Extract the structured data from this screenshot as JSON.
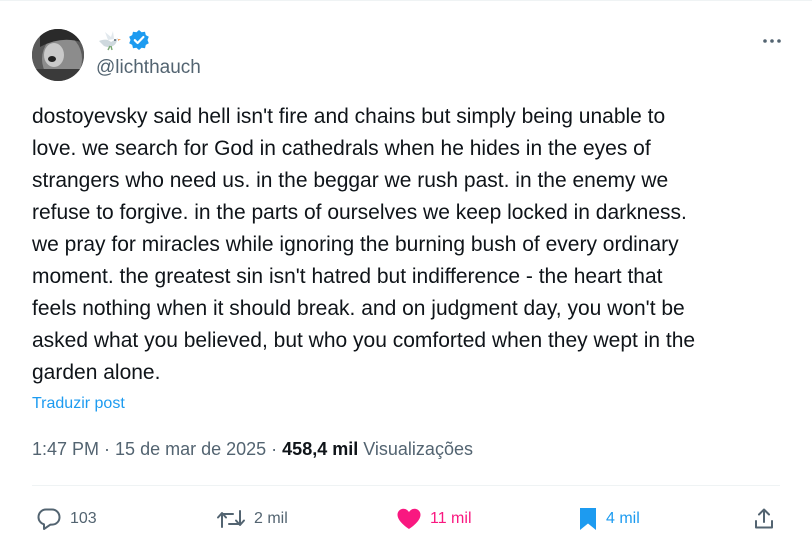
{
  "author": {
    "handle": "@lichthauch",
    "emoji_icon": "dove-icon",
    "verified_icon": "verified-badge-icon"
  },
  "post": {
    "text": "dostoyevsky said hell isn't fire and chains but simply being unable to\nlove. we search for God in cathedrals when he hides in the eyes of\nstrangers who need us. in the beggar we rush past. in the enemy we\nrefuse to forgive. in the parts of ourselves we keep locked in darkness.\nwe pray for miracles while ignoring the burning bush of every ordinary\nmoment. the greatest sin isn't hatred but indifference - the heart that\nfeels nothing when it should break. and on judgment day, you won't be\nasked what you believed, but who you comforted when they wept in the\ngarden alone.",
    "translate_label": "Traduzir post"
  },
  "meta": {
    "time": "1:47 PM",
    "separator": "·",
    "date": "15 de mar de 2025",
    "separator2": "·",
    "views_count": "458,4 mil",
    "views_label": "Visualizações"
  },
  "actions": {
    "replies": "103",
    "reposts": "2 mil",
    "likes": "11 mil",
    "bookmarks": "4 mil"
  },
  "colors": {
    "accent": "#1d9bf0",
    "like": "#f91880",
    "muted": "#536471",
    "text": "#0f1419"
  }
}
